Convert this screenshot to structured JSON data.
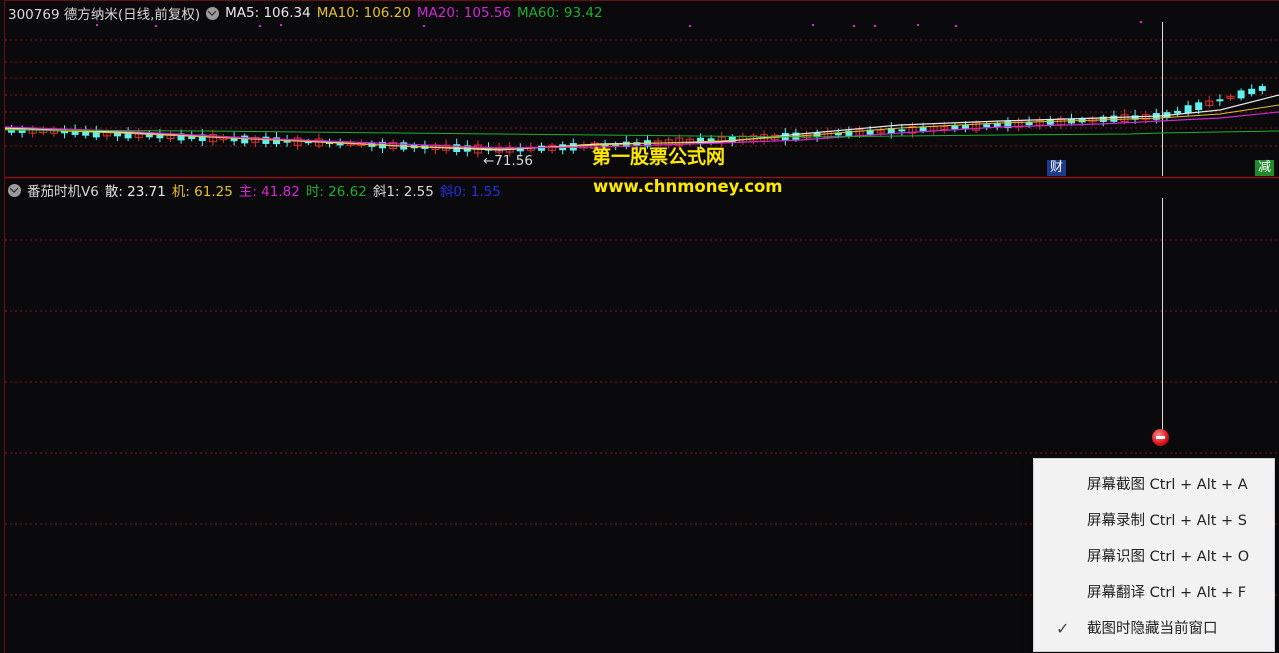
{
  "main_legend": {
    "title": "300769 德方纳米(日线,前复权)",
    "ma5": "MA5: 106.34",
    "ma10": "MA10: 106.20",
    "ma20": "MA20: 105.56",
    "ma60": "MA60: 93.42"
  },
  "sub_legend": {
    "title": "番茄时机V6",
    "san": "散: 23.71",
    "ji": "机: 61.25",
    "zhu": "主: 41.82",
    "shi": "时: 26.62",
    "xie1": "斜1: 2.55",
    "xie0": "斜0: 1.55"
  },
  "watermark": {
    "line1": "第一股票公式网",
    "line2": "www.chnmoney.com"
  },
  "low_label": "←71.56",
  "badges": {
    "cai": "财",
    "jian": "减"
  },
  "context_menu": [
    {
      "label": "屏幕截图 Ctrl + Alt + A",
      "checked": false
    },
    {
      "label": "屏幕录制 Ctrl + Alt + S",
      "checked": false
    },
    {
      "label": "屏幕识图 Ctrl + Alt + O",
      "checked": false
    },
    {
      "label": "屏幕翻译 Ctrl + Alt + F",
      "checked": false
    },
    {
      "label": "截图时隐藏当前窗口",
      "checked": true,
      "check_mark": "✓"
    }
  ],
  "colors": {
    "title": "#d8d8d8",
    "ma5": "#e8e8e8",
    "ma10": "#e7c02a",
    "ma20": "#d028d0",
    "ma60": "#1fae2e",
    "san": "#e8e8e8",
    "ji": "#e7c02a",
    "zhu": "#d028d0",
    "shi": "#1fae2e",
    "xie1": "#d8d8d8",
    "xie0": "#2030e0",
    "up_candle": "#e03030",
    "down_candle": "#5ff0f0",
    "grid": "#8a1515"
  }
}
